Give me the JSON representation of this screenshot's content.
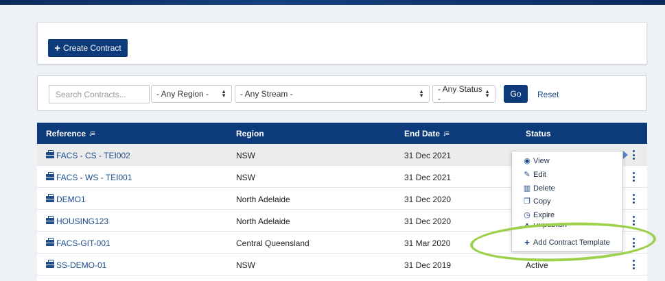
{
  "toolbar": {
    "create_label": "Create Contract"
  },
  "filters": {
    "search_placeholder": "Search Contracts...",
    "region": "- Any Region -",
    "stream": "- Any Stream -",
    "status": "- Any Status -",
    "go_label": "Go",
    "reset_label": "Reset"
  },
  "table": {
    "headers": {
      "reference": "Reference",
      "region": "Region",
      "end_date": "End Date",
      "status": "Status"
    },
    "rows": [
      {
        "reference": "FACS - CS - TEI002",
        "region": "NSW",
        "end_date": "31 Dec 2021",
        "status": ""
      },
      {
        "reference": "FACS - WS - TEI001",
        "region": "NSW",
        "end_date": "31 Dec 2021",
        "status": ""
      },
      {
        "reference": "DEMO1",
        "region": "North Adelaide",
        "end_date": "31 Dec 2020",
        "status": ""
      },
      {
        "reference": "HOUSING123",
        "region": "North Adelaide",
        "end_date": "31 Dec 2020",
        "status": ""
      },
      {
        "reference": "FACS-GIT-001",
        "region": "Central Queensland",
        "end_date": "31 Mar 2020",
        "status": ""
      },
      {
        "reference": "SS-DEMO-01",
        "region": "NSW",
        "end_date": "31 Dec 2019",
        "status": "Active"
      }
    ]
  },
  "menu": {
    "items": [
      {
        "label": "View",
        "icon": "eye-icon"
      },
      {
        "label": "Edit",
        "icon": "pencil-icon"
      },
      {
        "label": "Delete",
        "icon": "trash-icon"
      },
      {
        "label": "Copy",
        "icon": "copy-icon"
      },
      {
        "label": "Expire",
        "icon": "clock-icon"
      },
      {
        "label": "Unpublish",
        "icon": "unpublish-icon"
      },
      {
        "label": "Add Contract Template",
        "icon": "plus-icon"
      }
    ]
  },
  "colors": {
    "primary": "#0c3a7a",
    "link": "#1a4a8a",
    "highlight_ring": "#9dd14c"
  }
}
